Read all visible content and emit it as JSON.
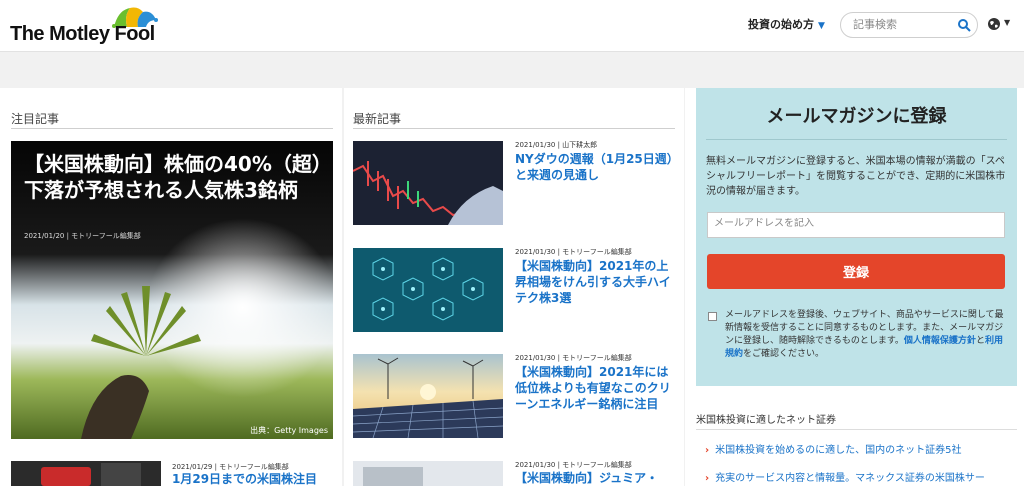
{
  "header": {
    "logo_text": "The Motley Fool",
    "nav_invest": "投資の始め方",
    "search_placeholder": "記事検索"
  },
  "featured": {
    "section_title": "注目記事",
    "title": "【米国株動向】株価の40%（超）下落が予想される人気株3銘柄",
    "meta": "2021/01/20 | モトリーフール編集部",
    "credit": "出典：Getty Images"
  },
  "left_card": {
    "meta": "2021/01/29 | モトリーフール編集部",
    "title": "1月29日までの米国株注目"
  },
  "latest": {
    "section_title": "最新記事",
    "items": [
      {
        "meta": "2021/01/30 | 山下耕太郎",
        "title": "NYダウの週報（1月25日週）と来週の見通し"
      },
      {
        "meta": "2021/01/30 | モトリーフール編集部",
        "title": "【米国株動向】2021年の上昇相場をけん引する大手ハイテク株3選"
      },
      {
        "meta": "2021/01/30 | モトリーフール編集部",
        "title": "【米国株動向】2021年には低位株よりも有望なこのクリーンエネルギー銘柄に注目"
      },
      {
        "meta": "2021/01/30 | モトリーフール編集部",
        "title": "【米国株動向】ジュミア・"
      }
    ]
  },
  "newsletter": {
    "title": "メールマガジンに登録",
    "description": "無料メールマガジンに登録すると、米国本場の情報が満載の「スペシャルフリーレポート」を閲覧することができ、定期的に米国株市況の情報が届きます。",
    "email_placeholder": "メールアドレスを記入",
    "button": "登録",
    "agree_prefix": "メールアドレスを登録後、ウェブサイト、商品やサービスに関して最新情報を受信することに同意するものとします。また、メールマガジンに登録し、随時解除できるものとします。",
    "privacy_link": "個人情報保護方針",
    "and": "と",
    "terms_link": "利用規約",
    "agree_suffix": "をご確認ください。"
  },
  "securities": {
    "title": "米国株投資に適したネット証券",
    "links": [
      "米国株投資を始めるのに適した、国内のネット証券5社",
      "充実のサービス内容と情報量。マネックス証券の米国株サー"
    ]
  },
  "colors": {
    "link": "#1a73c8",
    "cta": "#e4452a",
    "newsletter_bg": "#bfe3e8"
  }
}
